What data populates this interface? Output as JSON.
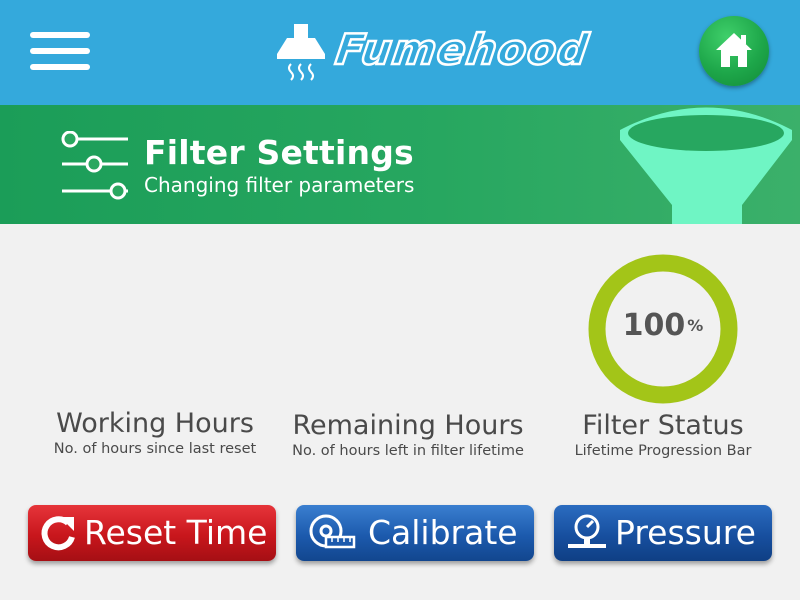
{
  "app": {
    "logo_text": "Fumehood"
  },
  "header": {
    "title": "Filter Settings",
    "subtitle": "Changing filter parameters"
  },
  "stats": {
    "working_hours": {
      "label": "Working Hours",
      "sub": "No. of hours since last reset"
    },
    "remaining_hours": {
      "label": "Remaining Hours",
      "sub": "No. of hours left in filter lifetime"
    },
    "filter_status": {
      "label": "Filter Status",
      "sub": "Lifetime Progression Bar",
      "value": "100",
      "unit": "%",
      "progress": 1.0
    }
  },
  "buttons": {
    "reset": "Reset Time",
    "calibrate": "Calibrate",
    "pressure": "Pressure"
  },
  "colors": {
    "topbar": "#34a9dc",
    "header_band": "#27a760",
    "gauge_ring": "#a3c518",
    "funnel": "#6ff5c4",
    "reset_button": "#c8161c",
    "calibrate_button": "#1c5aad",
    "pressure_button": "#174f9f"
  },
  "icons": {
    "menu": "hamburger-menu-icon",
    "logo": "range-hood-icon",
    "home": "home-icon",
    "header": "sliders-icon",
    "funnel": "funnel-icon",
    "reset": "reset-arrow-icon",
    "calibrate": "tape-measure-icon",
    "pressure": "pressure-gauge-icon"
  }
}
